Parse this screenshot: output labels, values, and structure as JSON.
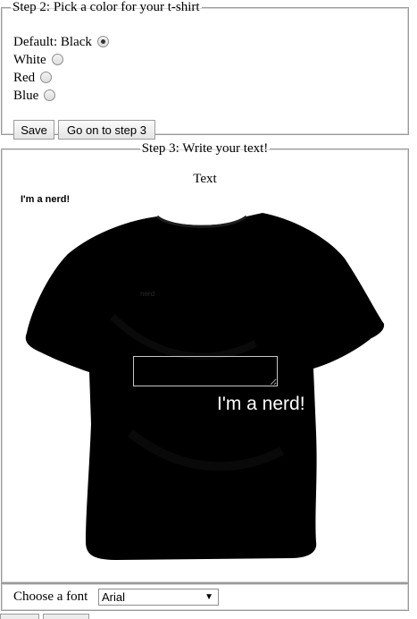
{
  "step2": {
    "legend": "Step 2: Pick a color for your t-shirt",
    "options": [
      {
        "label": "Default: Black",
        "checked": true
      },
      {
        "label": "White",
        "checked": false
      },
      {
        "label": "Red",
        "checked": false
      },
      {
        "label": "Blue",
        "checked": false
      }
    ],
    "save_label": "Save",
    "next_label": "Go on to step 3"
  },
  "step3": {
    "legend": "Step 3: Write your text!",
    "text_label": "Text",
    "preview_text": "I'm a nerd!",
    "faint_text": "nerd",
    "shirt_text": "I'm a nerd!",
    "shirt_color": "#000000"
  },
  "font": {
    "label": "Choose a font",
    "selected": "Arial"
  }
}
